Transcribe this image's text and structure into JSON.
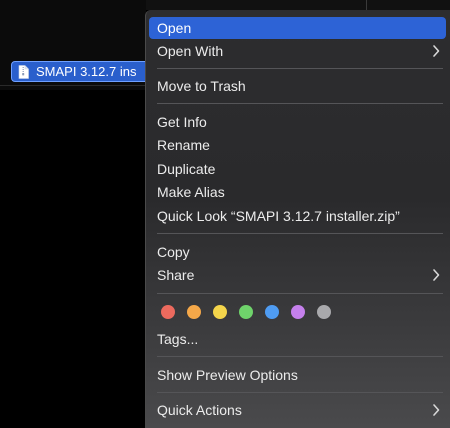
{
  "file": {
    "name": "SMAPI 3.12.7 ins",
    "icon": "document-icon"
  },
  "menu": {
    "items": [
      {
        "id": "open",
        "label": "Open",
        "highlighted": true
      },
      {
        "id": "open-with",
        "label": "Open With",
        "submenu": true
      },
      {
        "id": "move-to-trash",
        "label": "Move to Trash"
      },
      {
        "id": "get-info",
        "label": "Get Info"
      },
      {
        "id": "rename",
        "label": "Rename"
      },
      {
        "id": "duplicate",
        "label": "Duplicate"
      },
      {
        "id": "make-alias",
        "label": "Make Alias"
      },
      {
        "id": "quick-look",
        "label": "Quick Look “SMAPI 3.12.7 installer.zip”"
      },
      {
        "id": "copy",
        "label": "Copy"
      },
      {
        "id": "share",
        "label": "Share",
        "submenu": true
      },
      {
        "id": "tags",
        "label": "Tags..."
      },
      {
        "id": "show-preview-options",
        "label": "Show Preview Options"
      },
      {
        "id": "quick-actions",
        "label": "Quick Actions",
        "submenu": true
      }
    ],
    "tag_colors": [
      {
        "name": "red",
        "color": "#ec6a5e"
      },
      {
        "name": "orange",
        "color": "#f5a849"
      },
      {
        "name": "yellow",
        "color": "#f4d54b"
      },
      {
        "name": "green",
        "color": "#6fd36b"
      },
      {
        "name": "blue",
        "color": "#4f9cf2"
      },
      {
        "name": "purple",
        "color": "#c580ec"
      },
      {
        "name": "gray",
        "color": "#a9a9ac"
      }
    ],
    "highlight_color": "#2d63d6"
  }
}
